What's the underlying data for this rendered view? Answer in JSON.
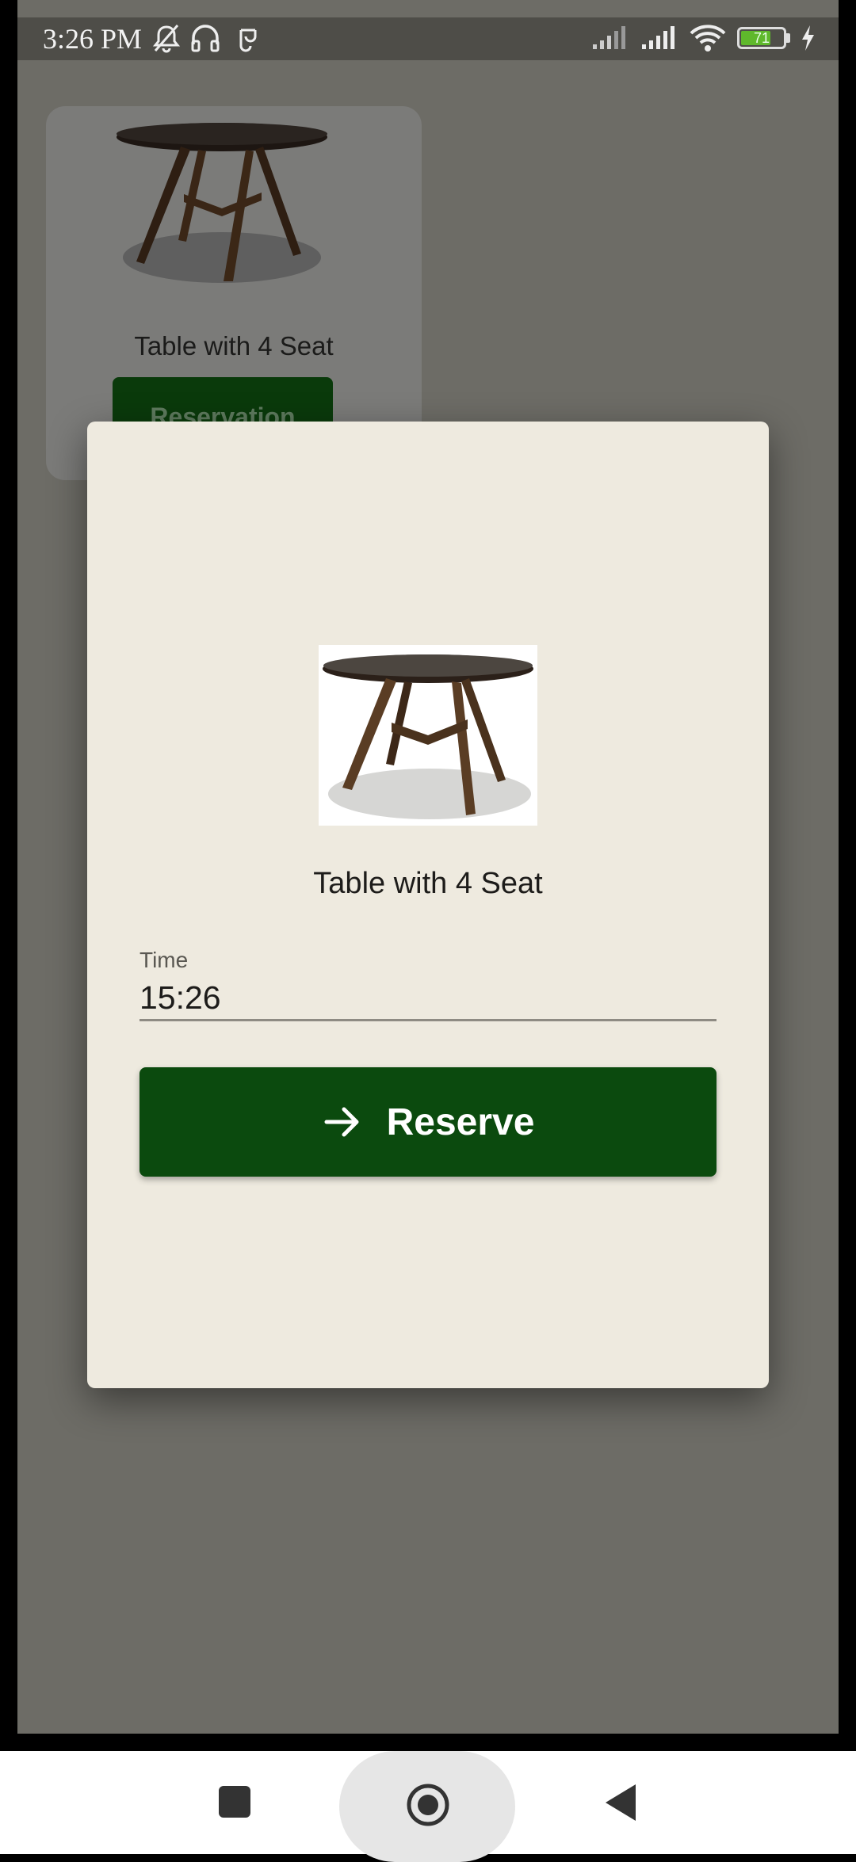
{
  "status_bar": {
    "time": "3:26 PM",
    "battery_level": "71",
    "battery_fraction": 0.71,
    "icons": [
      "mute-bell-icon",
      "headset-icon",
      "vpn-icon",
      "signal-icon",
      "signal-icon",
      "wifi-icon",
      "battery-icon",
      "charging-icon"
    ]
  },
  "background_card": {
    "title": "Table with 4 Seat",
    "button_label": "Reservation"
  },
  "dialog": {
    "title": "Table with 4 Seat",
    "time_field": {
      "label": "Time",
      "value": "15:26"
    },
    "reserve_button": {
      "icon": "arrow-right-icon",
      "label": "Reserve"
    }
  },
  "nav_bar": {
    "buttons": [
      "recents-icon",
      "home-icon",
      "back-icon"
    ]
  },
  "colors": {
    "primary_green": "#0b4a0e",
    "dialog_bg": "#eeeadf",
    "scrim": "#6d6c66"
  }
}
